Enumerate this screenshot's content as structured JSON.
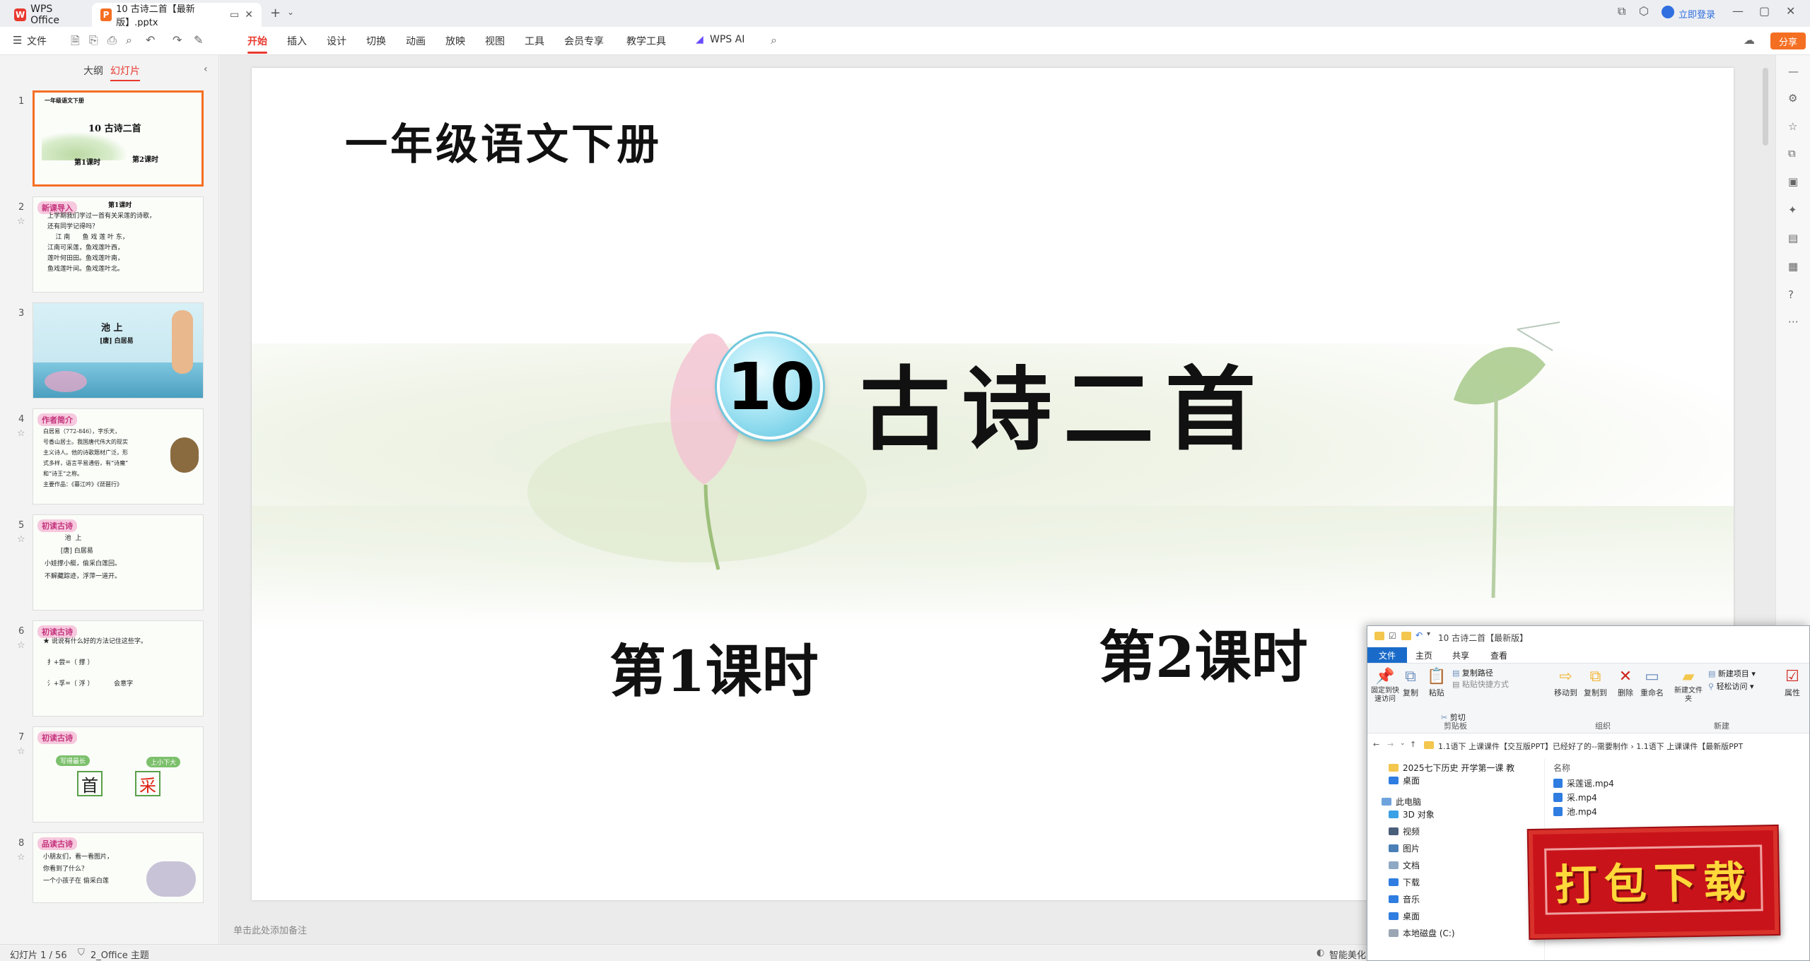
{
  "titlebar": {
    "app_name": "WPS Office",
    "doc_tab": "10 古诗二首【最新版】.pptx",
    "login": "立即登录"
  },
  "menu": {
    "file": "文件",
    "items": [
      "开始",
      "插入",
      "设计",
      "切换",
      "动画",
      "放映",
      "视图",
      "工具",
      "会员专享",
      "教学工具",
      "WPS AI"
    ],
    "active": "开始",
    "share": "分享"
  },
  "panel": {
    "tab_outline": "大纲",
    "tab_slides": "幻灯片",
    "add_slide": "+"
  },
  "thumbs": [
    {
      "num": "1",
      "title": "一年级语文下册",
      "center": "10 古诗二首",
      "l1": "第1课时",
      "l2": "第2课时"
    },
    {
      "num": "2",
      "badge": "新课导入",
      "head": "第1课时",
      "body": "上学期我们学过一首有关采莲的诗歌，\n还有同学记得吗？\n    江 南      鱼 戏 莲 叶 东，\n江南可采莲，鱼戏莲叶西，\n莲叶何田田。鱼戏莲叶南，\n鱼戏莲叶间。鱼戏莲叶北。"
    },
    {
      "num": "3",
      "title": "池 上",
      "sub": "[唐] 白居易"
    },
    {
      "num": "4",
      "badge": "作者简介",
      "body": "白居易（772-846），字乐天，\n号香山居士。我国唐代伟大的现实\n主义诗人。他的诗歌题材广泛，形\n式多样，语言平易通俗，有“诗魔”\n和“诗王”之称。\n主要作品：《暮江吟》《琵琶行》"
    },
    {
      "num": "5",
      "badge": "初读古诗",
      "body": "          池  上\n        [唐] 白居易\n小娃撑小艇，偷采白莲回。\n不解藏踪迹，浮萍一道开。"
    },
    {
      "num": "6",
      "badge": "初读古诗",
      "body": "★ 说说有什么好的方法记住这些字。\n\n  扌+尝=（ 撑 ）\n\n  氵+孚=（ 浮 ）          会意字"
    },
    {
      "num": "7",
      "badge": "初读古诗",
      "c1": "首",
      "c2": "采",
      "tag1": "写得最长",
      "tag2": "上小下大"
    },
    {
      "num": "8",
      "badge": "品读古诗",
      "body": "小朋友们，看一看图片，\n你看到了什么？\n一个小孩子在 偷采白莲"
    }
  ],
  "slide": {
    "heading": "一年级语文下册",
    "number": "10",
    "title": "古诗二首",
    "lesson1": "第1课时",
    "lesson2": "第2课时"
  },
  "notes_placeholder": "单击此处添加备注",
  "status": {
    "slide_counter": "幻灯片 1 / 56",
    "theme": "2_Office 主题",
    "beautify": "智能美化"
  },
  "explorer": {
    "title": "10 古诗二首【最新版】",
    "tabs": [
      "文件",
      "主页",
      "共享",
      "查看"
    ],
    "ribbon": {
      "pin": "固定到快速访问",
      "copy": "复制",
      "paste": "粘贴",
      "copy_path": "复制路径",
      "paste_shortcut": "粘贴快捷方式",
      "cut": "剪切",
      "group_clipboard": "剪贴板",
      "move_to": "移动到",
      "copy_to": "复制到",
      "delete": "删除",
      "rename": "重命名",
      "group_organize": "组织",
      "new_folder": "新建文件夹",
      "new_item": "新建项目",
      "easy_access": "轻松访问",
      "group_new": "新建",
      "properties": "属性"
    },
    "address": "1.1语下 上课课件【交互版PPT】已经好了的--需要制作  ›  1.1语下 上课课件【最新版PPT",
    "nav": [
      "2025七下历史 开学第一课 教",
      "桌面",
      "此电脑",
      "3D 对象",
      "视频",
      "图片",
      "文档",
      "下载",
      "音乐",
      "桌面",
      "本地磁盘 (C:)"
    ],
    "list_header": "名称",
    "files": [
      "采莲谣.mp4",
      "采.mp4",
      "池.mp4"
    ]
  },
  "download_banner": "打包下载",
  "colors": {
    "accent": "#e8392f",
    "share": "#f56f23",
    "explorer_file_tab": "#1a6bc9",
    "banner": "#c9131a"
  }
}
